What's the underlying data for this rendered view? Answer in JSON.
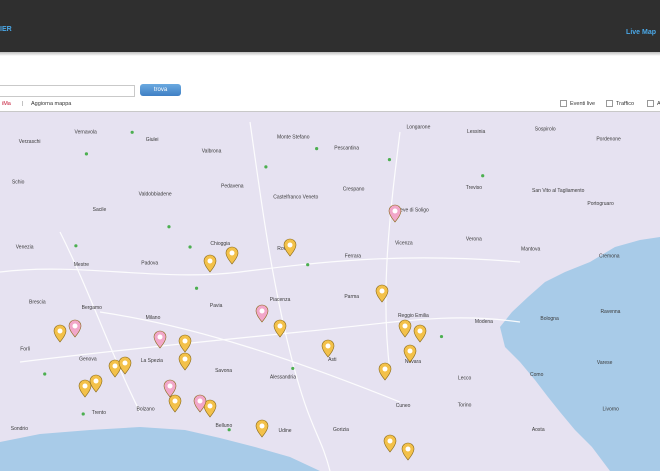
{
  "header": {
    "brand_text": "IER",
    "live_map_link": "Live Map"
  },
  "search": {
    "placeholder": "",
    "button_label": "trova"
  },
  "toolbar": {
    "mode_link": "iMa",
    "separator": "|",
    "refresh_link": "Aggiorna mappa",
    "toggles": [
      {
        "label": "Eventi live"
      },
      {
        "label": "Traffico"
      },
      {
        "label": "A"
      }
    ]
  },
  "map": {
    "sea_color": "#a8cbe8",
    "land_color": "#e6e2f1",
    "city_labels": [
      "Verzaschi",
      "Vernavola",
      "Giulei",
      "Valbrona",
      "Monte Stefano",
      "Pescantina",
      "Longarone",
      "Lessinia",
      "Sospirolo",
      "Pordenone",
      "Schio",
      "Sacile",
      "Valdobbiadene",
      "Pedavena",
      "Castelfranco Veneto",
      "Crespano",
      "Pieve di Soligo",
      "Treviso",
      "San Vito al Tagliamento",
      "Portogruaro",
      "Venezia",
      "Mestre",
      "Padova",
      "Chioggia",
      "Rovigo",
      "Ferrara",
      "Vicenza",
      "Verona",
      "Mantova",
      "Cremona",
      "Brescia",
      "Bergamo",
      "Milano",
      "Pavia",
      "Piacenza",
      "Parma",
      "Reggio Emilia",
      "Modena",
      "Bologna",
      "Ravenna",
      "Forlì",
      "Genova",
      "La Spezia",
      "Savona",
      "Alessandria",
      "Asti",
      "Novara",
      "Lecco",
      "Como",
      "Varese",
      "Sondrio",
      "Trento",
      "Bolzano",
      "Belluno",
      "Udine",
      "Gorizia",
      "Cuneo",
      "Torino",
      "Aosta",
      "Livorno"
    ]
  }
}
